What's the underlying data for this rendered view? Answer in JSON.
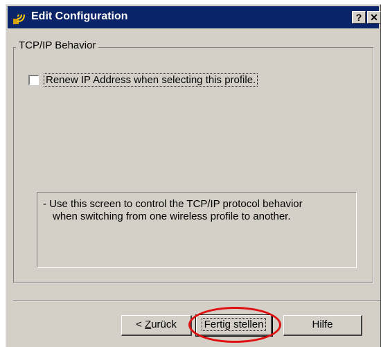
{
  "window": {
    "title": "Edit Configuration",
    "help_button": "?",
    "close_button": "✕"
  },
  "group": {
    "label": "TCP/IP Behavior",
    "checkbox_label": "Renew IP Address when selecting this profile.",
    "checkbox_checked": false
  },
  "info": {
    "line1": "- Use this screen to control the TCP/IP protocol behavior",
    "line2": "when switching from one wireless profile to another."
  },
  "buttons": {
    "back_prefix": "< ",
    "back_accel": "Z",
    "back_rest": "urück",
    "finish": "Fertig stellen",
    "help": "Hilfe"
  },
  "annotation": {
    "color": "#e01010"
  }
}
